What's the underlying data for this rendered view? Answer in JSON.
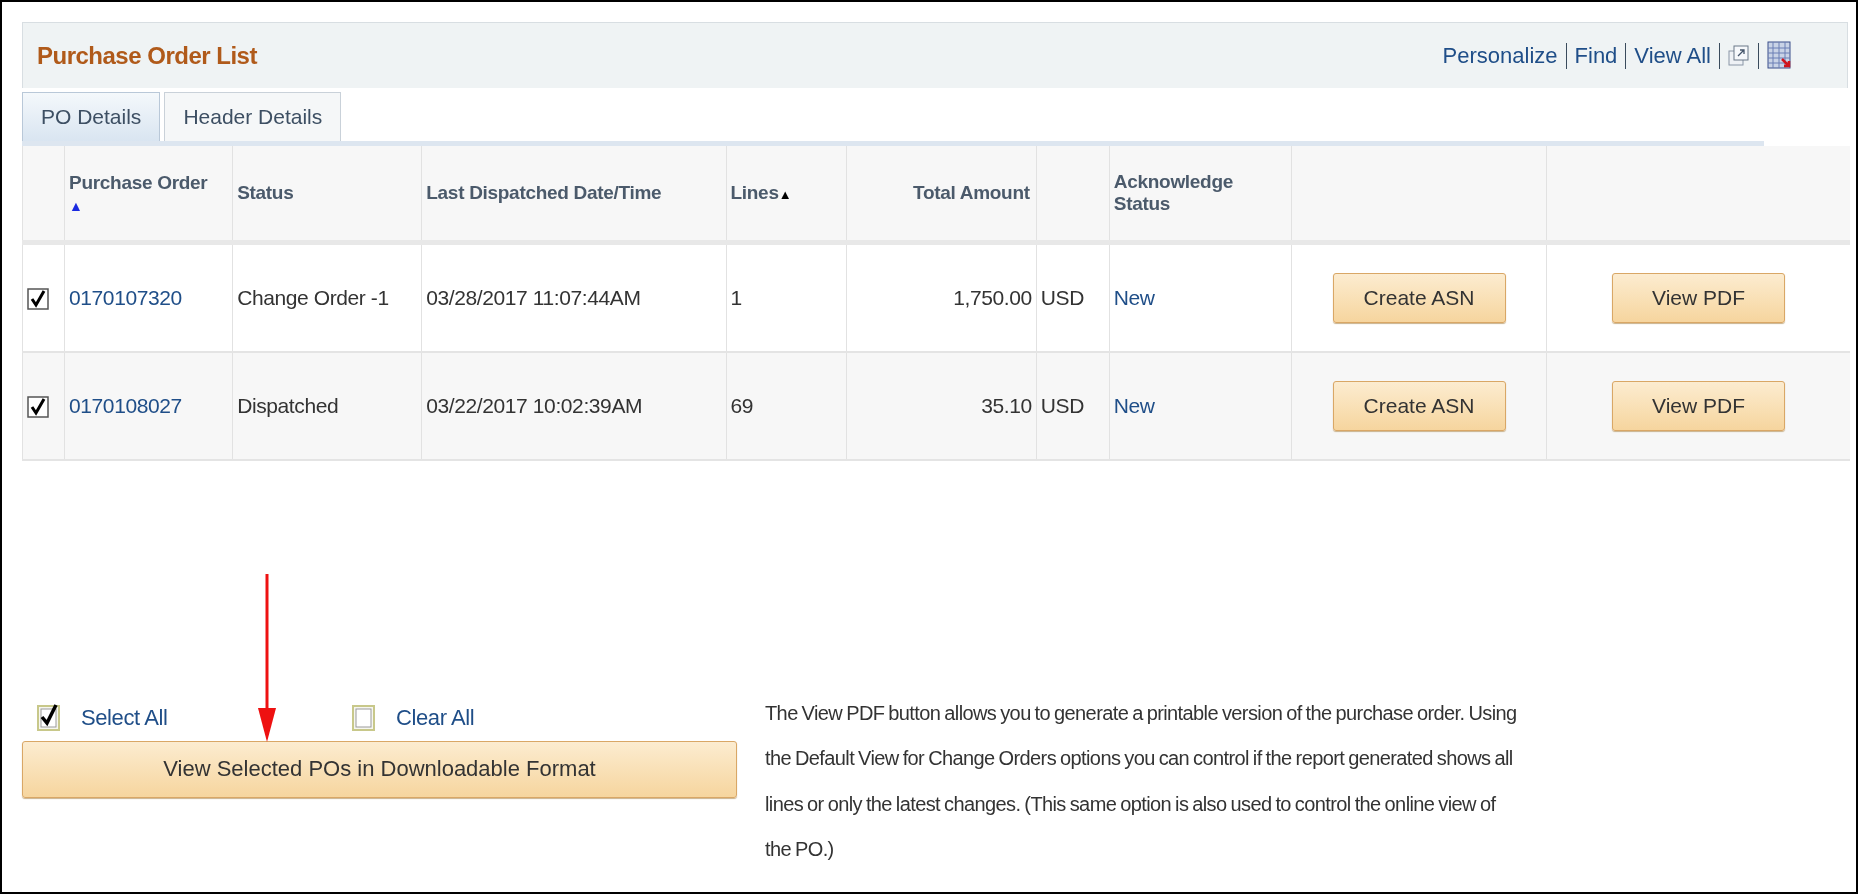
{
  "title": "Purchase Order List",
  "toolbar_links": [
    "Personalize",
    "Find",
    "View All"
  ],
  "tabs": [
    {
      "label": "PO Details",
      "selected": true
    },
    {
      "label": "Header Details",
      "selected": false
    }
  ],
  "table": {
    "columns": [
      {},
      {
        "label": "Purchase Order",
        "sort_marker": "▲",
        "kind": "below"
      },
      {
        "label": "Status"
      },
      {
        "label": "Last Dispatched Date/Time"
      },
      {
        "label": "Lines",
        "sort_marker": "▲",
        "kind": "inline"
      },
      {
        "label": "Total Amount"
      },
      {},
      {
        "label": "Acknowledge Status"
      },
      {},
      {}
    ],
    "rows": [
      {
        "checked": true,
        "po": "0170107320",
        "status": "Change Order -1",
        "dispatched": "03/28/2017 11:07:44AM",
        "lines": "1",
        "amount": "1,750.00",
        "currency": "USD",
        "ack": "New",
        "buttons": [
          "Create ASN",
          "View PDF"
        ]
      },
      {
        "checked": true,
        "po": "0170108027",
        "status": "Dispatched",
        "dispatched": "03/22/2017 10:02:39AM",
        "lines": "69",
        "amount": "35.10",
        "currency": "USD",
        "ack": "New",
        "buttons": [
          "Create ASN",
          "View PDF"
        ]
      }
    ]
  },
  "select_links": [
    {
      "label": "Select All",
      "checked": true
    },
    {
      "label": "Clear All",
      "checked": false
    }
  ],
  "download_button": "View Selected POs in Downloadable Format",
  "note": "The View PDF button allows you to generate a printable version of the purchase order. Using the Default View for Change Orders options you can control if the report generated shows all lines or only the latest changes. (This same option is also used to control the online view of the PO.)"
}
